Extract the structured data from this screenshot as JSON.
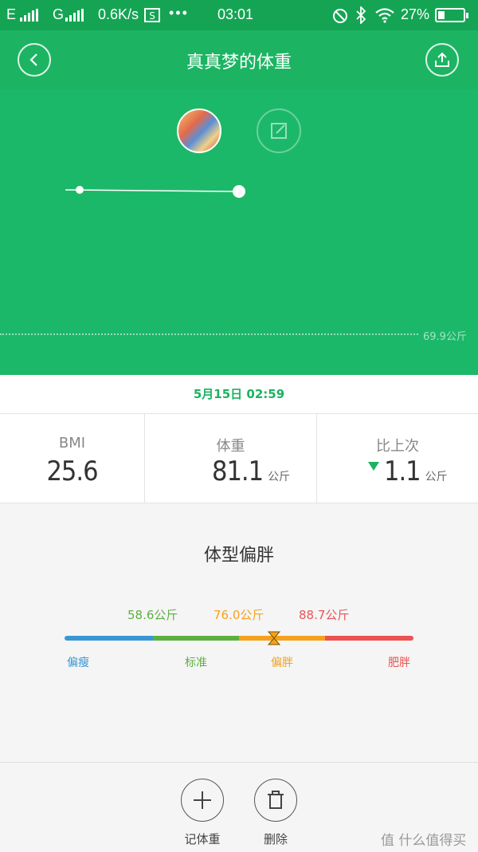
{
  "status_bar": {
    "network1": "E",
    "network2": "G",
    "speed": "0.6K/s",
    "time": "03:01",
    "battery": "27%"
  },
  "header": {
    "title": "真真梦的体重"
  },
  "chart": {
    "reference_label": "69.9公斤"
  },
  "record_date": "5月15日 02:59",
  "stats": {
    "bmi_label": "BMI",
    "bmi_value": "25.6",
    "weight_label": "体重",
    "weight_value": "81.1",
    "weight_unit": "公斤",
    "change_label": "比上次",
    "change_value": "1.1",
    "change_unit": "公斤",
    "change_direction": "down"
  },
  "body_type": {
    "title": "体型偏胖",
    "thresholds": [
      "58.6公斤",
      "76.0公斤",
      "88.7公斤"
    ],
    "categories": [
      "偏瘦",
      "标准",
      "偏胖",
      "肥胖"
    ],
    "colors": [
      "#3a97d4",
      "#5cb040",
      "#f4a21c",
      "#ec5252"
    ]
  },
  "toolbar": {
    "add_label": "记体重",
    "delete_label": "删除",
    "watermark": "值 什么值得买"
  }
}
